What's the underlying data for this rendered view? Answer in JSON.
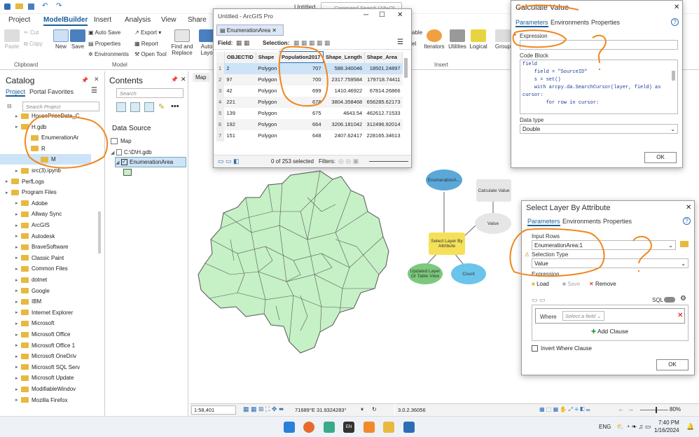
{
  "app": {
    "window_title": "Untitled",
    "command_search": "Command Search (Alt+Q)"
  },
  "ribbon": {
    "tabs": [
      "Project",
      "ModelBuilder",
      "Insert",
      "Analysis",
      "View",
      "Share"
    ],
    "clipboard": {
      "paste": "Paste",
      "cut": "Cut",
      "copy": "Copy",
      "group": "Clipboard"
    },
    "model": {
      "new": "New",
      "save": "Save",
      "auto_save": "Auto Save",
      "properties": "Properties",
      "environments": "Environments",
      "export": "Export",
      "report": "Report",
      "open_tool": "Open Tool",
      "find_replace": "Find and Replace",
      "auto_layout": "Auto Layo",
      "group": "Model"
    },
    "insert": {
      "able": "able",
      "el": "el",
      "iterators": "Iterators",
      "utilities": "Utilities",
      "logical": "Logical",
      "group": "Insert",
      "group_btn": "Group"
    }
  },
  "catalog": {
    "title": "Catalog",
    "tabs": [
      "Project",
      "Portal",
      "Favorites"
    ],
    "search_placeholder": "Search Project",
    "items": [
      {
        "label": "HousePriceData_C",
        "level": 1
      },
      {
        "label": "H.gdb",
        "level": 1
      },
      {
        "label": "EnumerationAr",
        "level": 2
      },
      {
        "label": "R",
        "level": 2
      },
      {
        "label": "M",
        "level": 3
      },
      {
        "label": "src(3).ipynb",
        "level": 1
      },
      {
        "label": "PerfLogs",
        "level": 0
      },
      {
        "label": "Program Files",
        "level": 0
      },
      {
        "label": "Adobe",
        "level": 1
      },
      {
        "label": "Allway Sync",
        "level": 1
      },
      {
        "label": "ArcGIS",
        "level": 1
      },
      {
        "label": "Autodesk",
        "level": 1
      },
      {
        "label": "BraveSoftware",
        "level": 1
      },
      {
        "label": "Classic Paint",
        "level": 1
      },
      {
        "label": "Common Files",
        "level": 1
      },
      {
        "label": "dotnet",
        "level": 1
      },
      {
        "label": "Google",
        "level": 1
      },
      {
        "label": "IBM",
        "level": 1
      },
      {
        "label": "Internet Explorer",
        "level": 1
      },
      {
        "label": "Microsoft",
        "level": 1
      },
      {
        "label": "Microsoft Office",
        "level": 1
      },
      {
        "label": "Microsoft Office 1",
        "level": 1
      },
      {
        "label": "Microsoft OneDriv",
        "level": 1
      },
      {
        "label": "Microsoft SQL Serv",
        "level": 1
      },
      {
        "label": "Microsoft Update",
        "level": 1
      },
      {
        "label": "ModifiableWindov",
        "level": 1
      },
      {
        "label": "Mozilla Firefox",
        "level": 1
      }
    ]
  },
  "contents": {
    "title": "Contents",
    "search_placeholder": "Search",
    "data_source": "Data Source",
    "map": "Map",
    "path": "C:\\D\\H.gdb",
    "layer": "EnumerationArea"
  },
  "map": {
    "tab": "Map",
    "scale": "1:58,401",
    "coords": "71689°E 31.9324283°"
  },
  "model_view": {
    "version": "3.0.2.36056",
    "zoom": "80%"
  },
  "table_window": {
    "title": "Untitled - ArcGIS Pro",
    "tab": "EnumerationArea",
    "field_label": "Field:",
    "selection_label": "Selection:",
    "columns": [
      "OBJECTID",
      "Shape",
      "Population2017",
      "Shape_Length",
      "Shape_Area"
    ],
    "rows": [
      [
        "1",
        "2",
        "Polygon",
        "707",
        "588.340046",
        "18501.24897"
      ],
      [
        "2",
        "97",
        "Polygon",
        "700",
        "2317.759584",
        "179718.74411"
      ],
      [
        "3",
        "42",
        "Polygon",
        "699",
        "1410.46922",
        "67814.26866"
      ],
      [
        "4",
        "221",
        "Polygon",
        "678",
        "3804.358468",
        "656285.62173"
      ],
      [
        "5",
        "139",
        "Polygon",
        "675",
        "4643.54",
        "462612.71533"
      ],
      [
        "6",
        "192",
        "Polygon",
        "664",
        "3206.181042",
        "312496.92014"
      ],
      [
        "7",
        "151",
        "Polygon",
        "648",
        "2407.62417",
        "228165.34613"
      ]
    ],
    "status": "0 of 253 selected",
    "filters": "Filters:"
  },
  "calc_dialog": {
    "title": "Calculate Value",
    "tabs": [
      "Parameters",
      "Environments",
      "Properties"
    ],
    "expression_label": "Expression",
    "code_block_label": "Code Block",
    "code": [
      "field",
      "    field = \"SourceID\"",
      "    s = set()",
      "    with arcpy.da.SearchCursor(layer, field) as",
      "cursor:",
      "        for row in cursor:"
    ],
    "data_type_label": "Data type",
    "data_type": "Double",
    "ok": "OK"
  },
  "select_dialog": {
    "title": "Select Layer By Attribute",
    "tabs": [
      "Parameters",
      "Environments",
      "Properties"
    ],
    "input_rows_label": "Input Rows",
    "input_rows": "EnumerationArea:1",
    "selection_type_label": "Selection Type",
    "selection_type": "Value",
    "expression_label": "Expression",
    "load": "Load",
    "save": "Save",
    "remove": "Remove",
    "sql": "SQL",
    "where": "Where",
    "field_placeholder": "Select a field",
    "add_clause": "Add Clause",
    "invert": "Invert Where Clause",
    "ok": "OK"
  },
  "model_nodes": {
    "enum": "EnumerationA...",
    "calc": "Calculate Value",
    "value": "Value",
    "select": "Select Layer By Attribute",
    "updated": "Updated Layer Or Table View",
    "count": "Count"
  },
  "taskbar": {
    "lang": "ENG",
    "time": "7:40 PM",
    "date": "1/16/2024"
  }
}
